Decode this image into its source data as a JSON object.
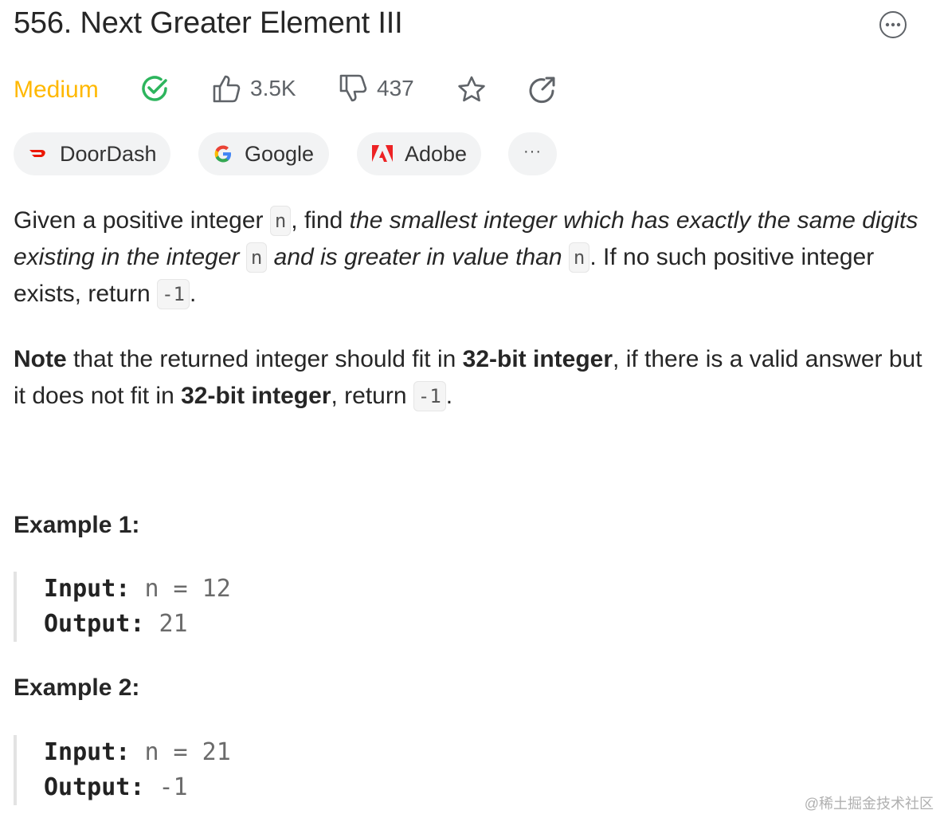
{
  "problem": {
    "title": "556. Next Greater Element III"
  },
  "meta": {
    "difficulty": "Medium",
    "difficulty_color": "#ffb800",
    "solved_icon": "check-circle-icon",
    "likes": "3.5K",
    "dislikes": "437"
  },
  "tags": [
    {
      "label": "DoorDash",
      "icon": "doordash-logo"
    },
    {
      "label": "Google",
      "icon": "google-logo"
    },
    {
      "label": "Adobe",
      "icon": "adobe-logo"
    },
    {
      "label": "···",
      "icon": "more-icon"
    }
  ],
  "description": {
    "p1": {
      "t1": "Given a positive integer ",
      "c1": "n",
      "t2": ", find ",
      "em1": "the smallest integer which has exactly the same digits existing in the integer ",
      "c2": "n",
      "em2": " and is greater in value than ",
      "c3": "n",
      "t3": ". If no such positive integer exists, return ",
      "c4": "-1",
      "t4": "."
    },
    "p2": {
      "b1": "Note",
      "t1": " that the returned integer should fit in ",
      "b2": "32-bit integer",
      "t2": ", if there is a valid answer but it does not fit in ",
      "b3": "32-bit integer",
      "t3": ", return ",
      "c1": "-1",
      "t4": "."
    }
  },
  "examples": [
    {
      "title": "Example 1:",
      "input_label": "Input:",
      "input_value": "n = 12",
      "output_label": "Output:",
      "output_value": "21"
    },
    {
      "title": "Example 2:",
      "input_label": "Input:",
      "input_value": "n = 21",
      "output_label": "Output:",
      "output_value": "-1"
    }
  ],
  "watermark": "@稀土掘金技术社区"
}
